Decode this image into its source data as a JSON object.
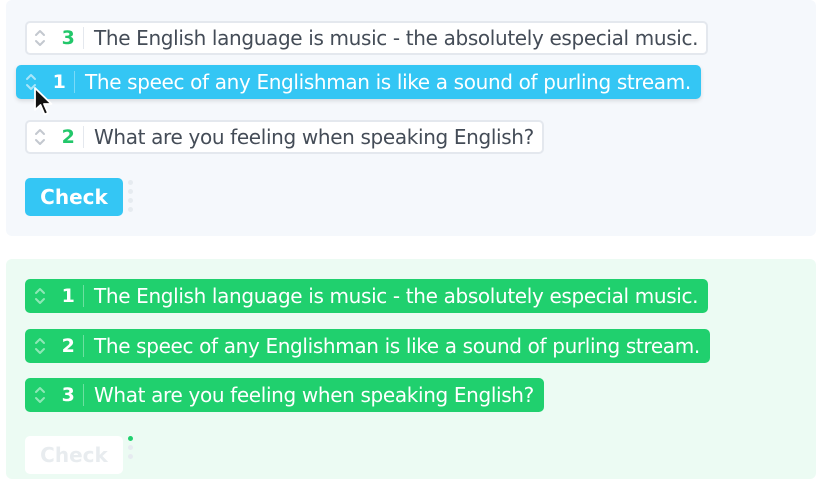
{
  "exercise_top": {
    "items": [
      {
        "number": "3",
        "text": "The English language is music - the absolutely especial music.",
        "state": "plain"
      },
      {
        "number": "1",
        "text": "The speec of any Englishman is like a sound of purling stream.",
        "state": "selected"
      },
      {
        "number": "2",
        "text": "What are you feeling when speaking English?",
        "state": "plain"
      }
    ],
    "check_label": "Check"
  },
  "exercise_bottom": {
    "items": [
      {
        "number": "1",
        "text": "The English language is music - the absolutely especial music.",
        "state": "correct"
      },
      {
        "number": "2",
        "text": "The speec of any Englishman is like a sound of purling stream.",
        "state": "correct"
      },
      {
        "number": "3",
        "text": "What are you feeling when speaking English?",
        "state": "correct"
      }
    ],
    "check_label": "Check"
  },
  "colors": {
    "selected": "#34c6f4",
    "correct": "#20d06e",
    "number_green": "#22c76a",
    "panel_top_bg": "#f5f8fc",
    "panel_bottom_bg": "#ecfbf3"
  },
  "icons": {
    "handle": "sort-handle-icon",
    "cursor": "mouse-pointer-icon"
  }
}
